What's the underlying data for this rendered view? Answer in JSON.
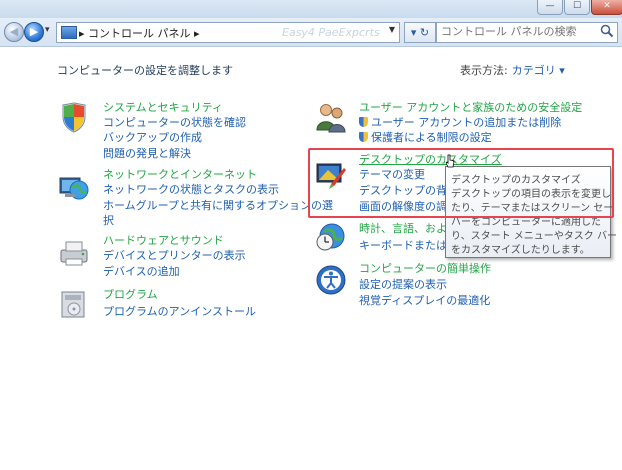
{
  "window": {
    "minimize_glyph": "—",
    "maximize_glyph": "☐",
    "close_glyph": "✕"
  },
  "nav": {
    "back_glyph": "◀",
    "forward_glyph": "▶",
    "history_glyph": "▾",
    "address_icon": "control-panel-icon",
    "address_text": "▸ コントロール パネル ▸",
    "watermark": "Easy4 PaeExpcrts",
    "refresh_glyph": "▾ ↻",
    "search_placeholder": "コントロール パネルの検索"
  },
  "header": {
    "title": "コンピューターの設定を調整します",
    "view_by_label": "表示方法:",
    "view_by_value": "カテゴリ ▾"
  },
  "categories": {
    "system": {
      "icon": "system-security-icon",
      "title": "システムとセキュリティ",
      "links": [
        "コンピューターの状態を確認",
        "バックアップの作成",
        "問題の発見と解決"
      ]
    },
    "network": {
      "icon": "network-icon",
      "title": "ネットワークとインターネット",
      "links": [
        "ネットワークの状態とタスクの表示",
        "ホームグループと共有に関するオプションの選",
        "択"
      ]
    },
    "hardware": {
      "icon": "hardware-sound-icon",
      "title": "ハードウェアとサウンド",
      "links": [
        "デバイスとプリンターの表示",
        "デバイスの追加"
      ]
    },
    "programs": {
      "icon": "programs-icon",
      "title": "プログラム",
      "links": [
        "プログラムのアンインストール"
      ]
    },
    "users": {
      "icon": "user-accounts-icon",
      "title": "ユーザー アカウントと家族のための安全設定",
      "links": [
        "ユーザー アカウントの追加または削除",
        "保護者による制限の設定"
      ]
    },
    "appearance": {
      "icon": "appearance-icon",
      "title": "デスクトップのカスタマイズ",
      "links": [
        "テーマの変更",
        "デスクトップの背景の",
        "画面の解像度の調整"
      ]
    },
    "clock": {
      "icon": "clock-language-icon",
      "title": "時計、言語、および地",
      "links": [
        "キーボードまたは入力"
      ]
    },
    "ease": {
      "icon": "ease-of-access-icon",
      "title": "コンピューターの簡単操作",
      "links": [
        "設定の提案の表示",
        "視覚ディスプレイの最適化"
      ]
    }
  },
  "tooltip": {
    "lines": [
      "デスクトップのカスタマイズ",
      "デスクトップの項目の表示を変更し",
      "たり、テーマまたはスクリーン セー",
      "バーをコンピューターに適用した",
      "り、スタート メニューやタスク バー",
      "をカスタマイズしたりします。"
    ]
  },
  "colors": {
    "link": "#1f5fb2",
    "category_title": "#21a545",
    "highlight": "#e8444f"
  }
}
